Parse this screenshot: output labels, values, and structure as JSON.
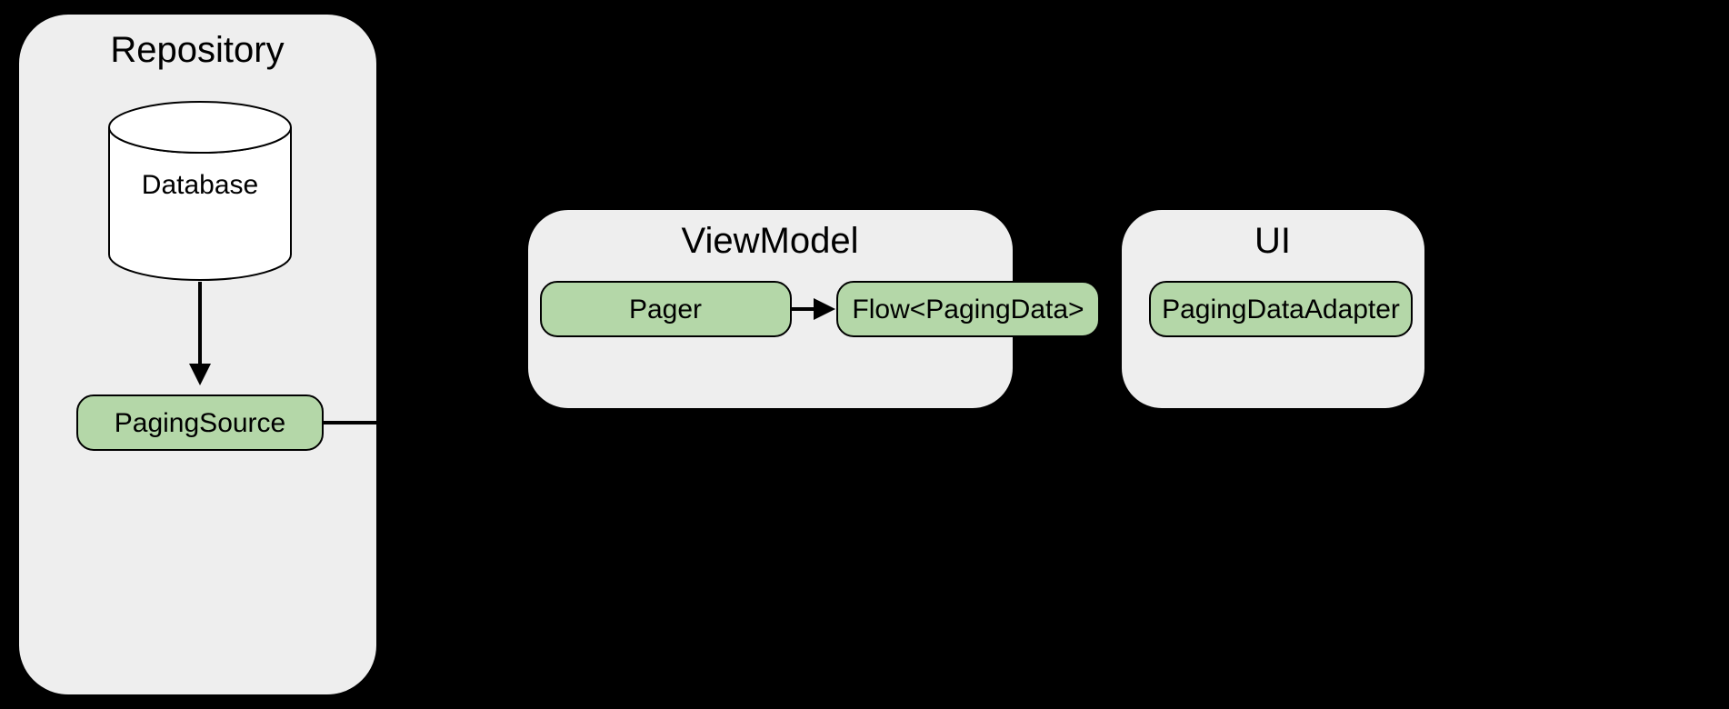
{
  "repository": {
    "title": "Repository",
    "database_label": "Database",
    "paging_source_label": "PagingSource"
  },
  "viewmodel": {
    "title": "ViewModel",
    "pager_label": "Pager",
    "flow_label": "Flow<PagingData>"
  },
  "ui": {
    "title": "UI",
    "adapter_label": "PagingDataAdapter"
  }
}
